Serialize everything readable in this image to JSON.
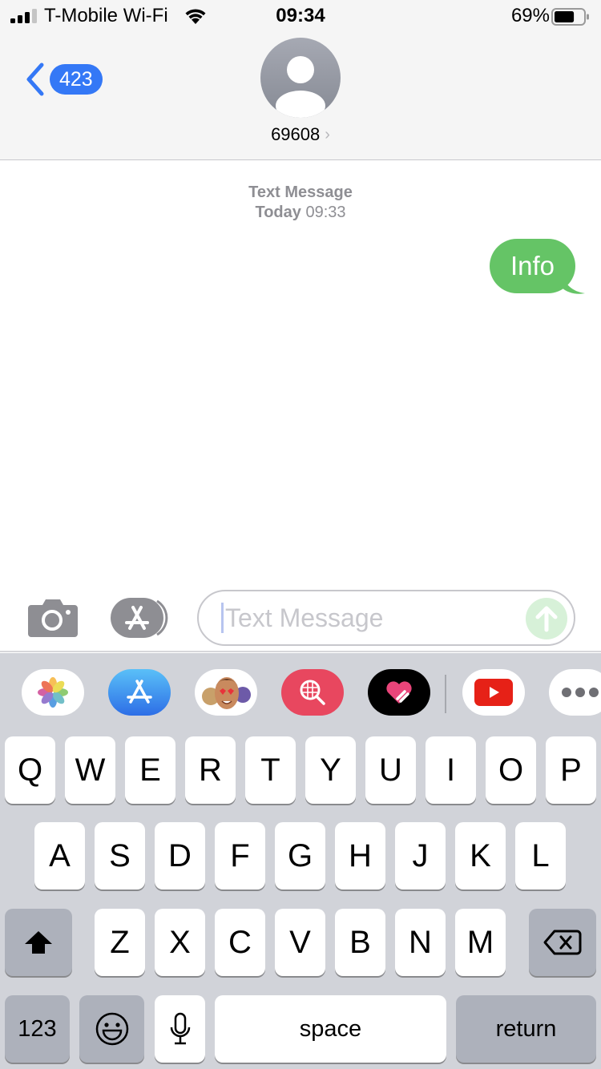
{
  "status_bar": {
    "carrier": "T-Mobile Wi-Fi",
    "time": "09:34",
    "battery_percent": "69%",
    "battery_level": 0.69,
    "signal_bars": 3,
    "signal_bars_total": 4,
    "icons": [
      "signal-icon",
      "wifi-icon",
      "battery-icon"
    ]
  },
  "nav": {
    "back_badge": "423",
    "contact_name": "69608",
    "contact_chevron": "›",
    "icons": [
      "back-chevron-icon",
      "avatar-person-icon",
      "chevron-right-icon"
    ]
  },
  "conversation": {
    "header_line1": "Text Message",
    "header_line2_day": "Today",
    "header_line2_time": "09:33",
    "messages": [
      {
        "direction": "outgoing",
        "text": "Info",
        "color": "#65c466"
      }
    ]
  },
  "composer": {
    "placeholder": "Text Message",
    "value": "",
    "icons": [
      "camera-icon",
      "app-store-icon",
      "send-arrow-icon"
    ]
  },
  "app_strip": {
    "apps": [
      {
        "name": "photos-app-icon"
      },
      {
        "name": "app-store-app-icon"
      },
      {
        "name": "memoji-stickers-app-icon"
      },
      {
        "name": "images-search-app-icon"
      },
      {
        "name": "digital-touch-app-icon"
      },
      {
        "name": "youtube-app-icon"
      },
      {
        "name": "more-apps-icon"
      }
    ]
  },
  "keyboard": {
    "row1": [
      "Q",
      "W",
      "E",
      "R",
      "T",
      "Y",
      "U",
      "I",
      "O",
      "P"
    ],
    "row2": [
      "A",
      "S",
      "D",
      "F",
      "G",
      "H",
      "J",
      "K",
      "L"
    ],
    "row3": [
      "Z",
      "X",
      "C",
      "V",
      "B",
      "N",
      "M"
    ],
    "numbers_label": "123",
    "space_label": "space",
    "return_label": "return"
  }
}
